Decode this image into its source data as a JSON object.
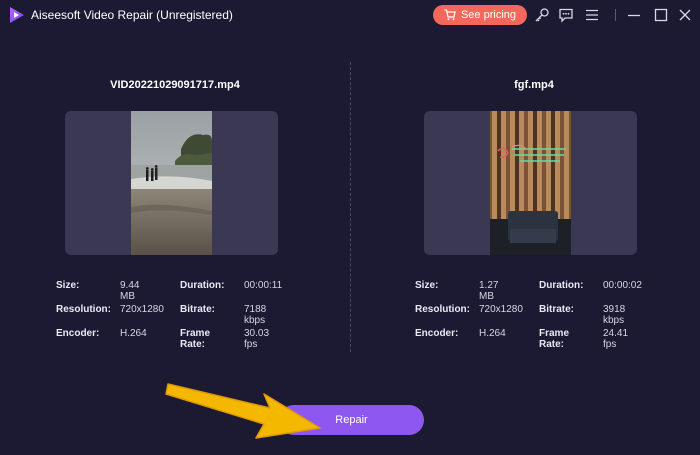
{
  "app": {
    "title": "Aiseesoft Video Repair (Unregistered)"
  },
  "toolbar": {
    "pricing_label": "See pricing"
  },
  "colors": {
    "accent": "#8e58f0",
    "pricing": "#f2685a",
    "background": "#1c1a33",
    "arrow": "#f5b800"
  },
  "videos": [
    {
      "filename": "VID20221029091717.mp4",
      "size_label": "Size:",
      "size": "9.44 MB",
      "duration_label": "Duration:",
      "duration": "00:00:11",
      "resolution_label": "Resolution:",
      "resolution": "720x1280",
      "bitrate_label": "Bitrate:",
      "bitrate": "7188 kbps",
      "encoder_label": "Encoder:",
      "encoder": "H.264",
      "framerate_label": "Frame Rate:",
      "framerate": "30.03 fps"
    },
    {
      "filename": "fgf.mp4",
      "size_label": "Size:",
      "size": "1.27 MB",
      "duration_label": "Duration:",
      "duration": "00:00:02",
      "resolution_label": "Resolution:",
      "resolution": "720x1280",
      "bitrate_label": "Bitrate:",
      "bitrate": "3918 kbps",
      "encoder_label": "Encoder:",
      "encoder": "H.264",
      "framerate_label": "Frame Rate:",
      "framerate": "24.41 fps"
    }
  ],
  "actions": {
    "repair_label": "Repair"
  },
  "icons": [
    "app-logo-icon",
    "cart-icon",
    "key-icon",
    "feedback-icon",
    "menu-icon",
    "minimize-icon",
    "maximize-icon",
    "close-icon",
    "pointer-arrow-icon"
  ]
}
